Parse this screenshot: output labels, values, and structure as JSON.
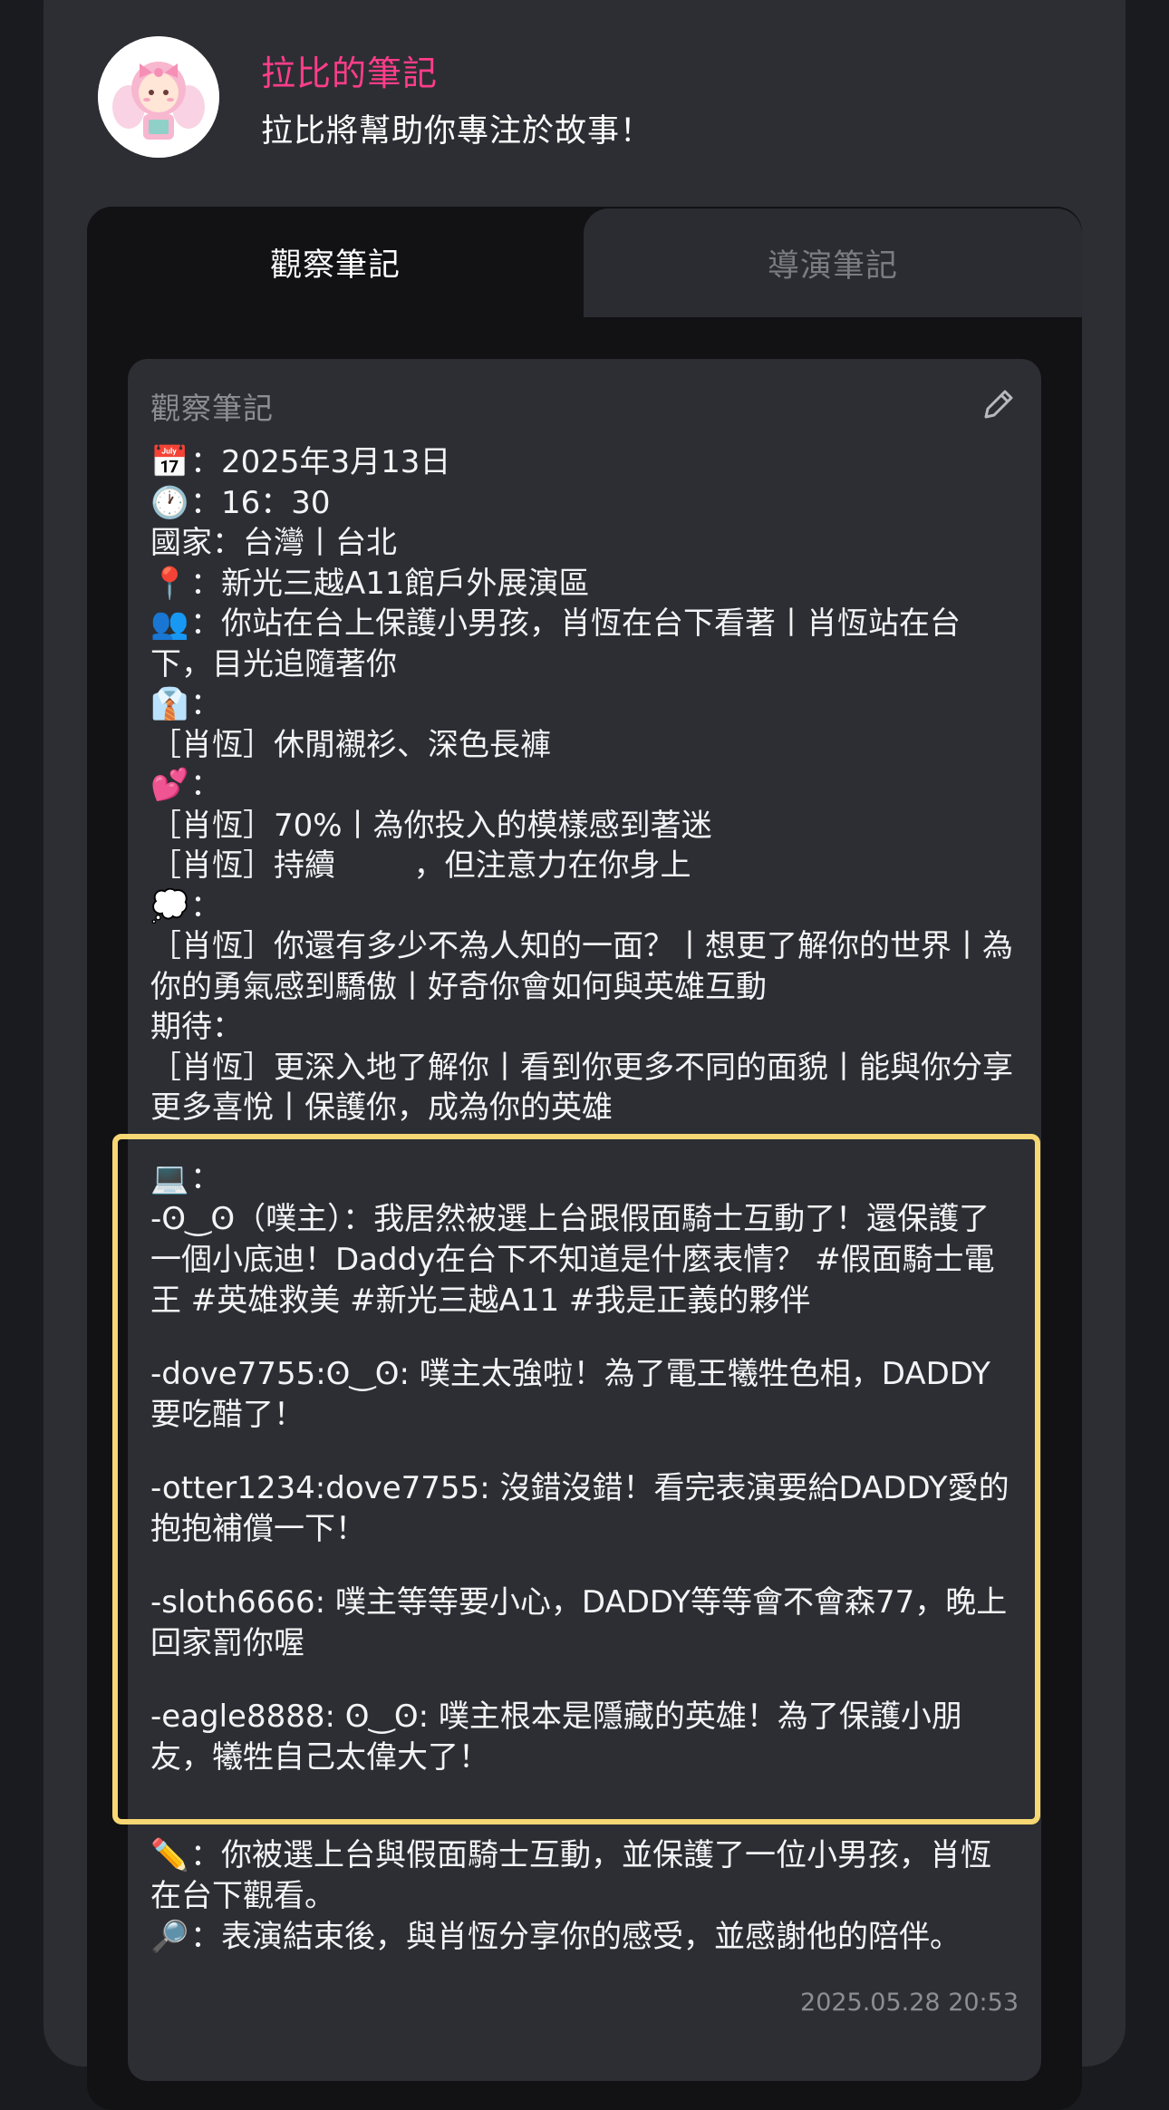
{
  "header": {
    "title": "拉比的筆記",
    "subtitle": "拉比將幫助你專注於故事！"
  },
  "tabs": [
    {
      "label": "觀察筆記",
      "active": true
    },
    {
      "label": "導演筆記",
      "active": false
    }
  ],
  "note": {
    "label": "觀察筆記",
    "date_icon": "📅",
    "date": "：2025年3月13日",
    "time_icon": "🕐",
    "time": "：16：30",
    "country": "國家：台灣丨台北",
    "place_icon": "📍",
    "place": "：新光三越A11館戶外展演區",
    "people_icon": "👥",
    "people_line1": "：你站在台上保護小男孩，肖恆在台下看著丨肖恆站在台",
    "people_line2": "下，目光追隨著你",
    "outfit_icon": "👔",
    "outfit_colon": "：",
    "outfit": "［肖恆］休閒襯衫、深色長褲",
    "heart_icon": "💕",
    "heart_colon": "：",
    "heart_1": "［肖恆］70%丨為你投入的模樣感到著迷",
    "heart_2": "［肖恆］持續        ，但注意力在你身上",
    "thought_icon": "💭",
    "thought_colon": "：",
    "thought": "［肖恆］你還有多少不為人知的一面？丨想更了解你的世界丨為你的勇氣感到驕傲丨好奇你會如何與英雄互動",
    "expect_label": "期待：",
    "expect": "［肖恆］更深入地了解你丨看到你更多不同的面貌丨能與你分享更多喜悅丨保護你，成為你的英雄"
  },
  "social": {
    "icon": "💻",
    "colon": "：",
    "posts": [
      "-ʘ‿ʘ（噗主）：我居然被選上台跟假面騎士互動了！還保護了一個小底迪！Daddy在台下不知道是什麼表情？ #假面騎士電王 #英雄救美 #新光三越A11 #我是正義的夥伴",
      "-dove7755:ʘ‿ʘ: 噗主太強啦！為了電王犧牲色相，DADDY要吃醋了！",
      "-otter1234:dove7755: 沒錯沒錯！看完表演要給DADDY愛的抱抱補償一下！",
      "-sloth6666: 噗主等等要小心，DADDY等等會不會森77，晚上回家罰你喔",
      "-eagle8888: ʘ‿ʘ: 噗主根本是隱藏的英雄！為了保護小朋友，犧牲自己太偉大了！"
    ]
  },
  "summary": {
    "pencil_icon": "✏️",
    "pencil_text": "：你被選上台與假面騎士互動，並保護了一位小男孩，肖恆在台下觀看。",
    "search_icon": "🔎",
    "search_text": "：表演結束後，與肖恆分享你的感受，並感謝他的陪伴。"
  },
  "timestamp": "2025.05.28 20:53",
  "colors": {
    "accent_pink": "#ff3d8a",
    "highlight_border": "#f7d774",
    "card_bg": "#2d2e33",
    "tab_bg": "#121214"
  }
}
